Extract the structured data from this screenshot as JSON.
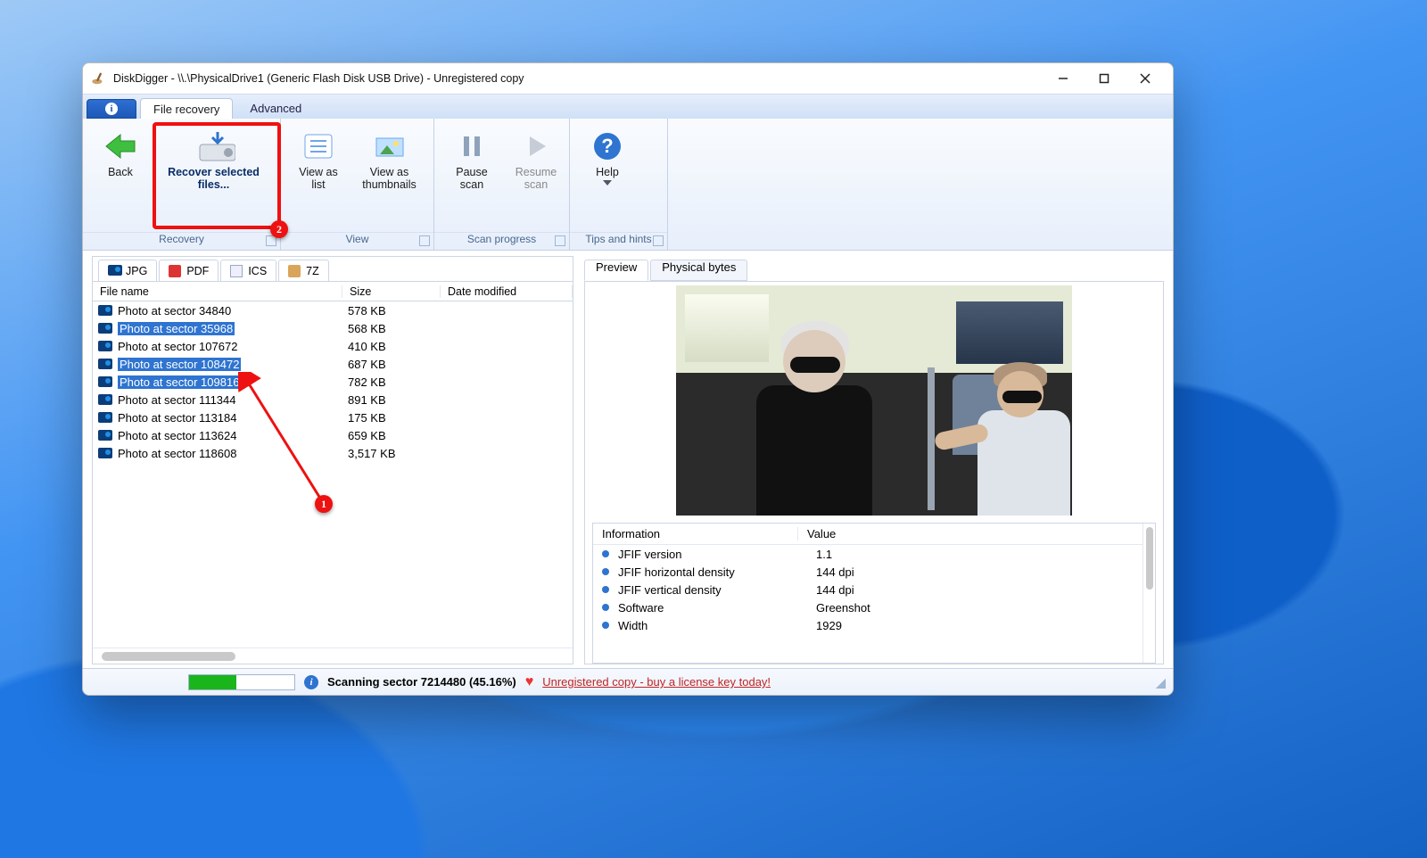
{
  "window": {
    "title": "DiskDigger - \\\\.\\PhysicalDrive1 (Generic Flash Disk USB Drive) - Unregistered copy"
  },
  "tabs": {
    "file_recovery": "File recovery",
    "advanced": "Advanced"
  },
  "ribbon": {
    "back": "Back",
    "recover": "Recover selected files...",
    "view_list": "View as list",
    "view_thumbs": "View as thumbnails",
    "pause": "Pause scan",
    "resume": "Resume scan",
    "help": "Help",
    "group_recovery": "Recovery",
    "group_view": "View",
    "group_scan": "Scan progress",
    "group_tips": "Tips and hints"
  },
  "file_types": {
    "jpg": "JPG",
    "pdf": "PDF",
    "ics": "ICS",
    "sevenz": "7Z"
  },
  "columns": {
    "name": "File name",
    "size": "Size",
    "modified": "Date modified"
  },
  "files": [
    {
      "name": "Photo at sector 34840",
      "size": "578 KB",
      "selected": false
    },
    {
      "name": "Photo at sector 35968",
      "size": "568 KB",
      "selected": true
    },
    {
      "name": "Photo at sector 107672",
      "size": "410 KB",
      "selected": false
    },
    {
      "name": "Photo at sector 108472",
      "size": "687 KB",
      "selected": true
    },
    {
      "name": "Photo at sector 109816",
      "size": "782 KB",
      "selected": true
    },
    {
      "name": "Photo at sector 111344",
      "size": "891 KB",
      "selected": false
    },
    {
      "name": "Photo at sector 113184",
      "size": "175 KB",
      "selected": false
    },
    {
      "name": "Photo at sector 113624",
      "size": "659 KB",
      "selected": false
    },
    {
      "name": "Photo at sector 118608",
      "size": "3,517 KB",
      "selected": false
    }
  ],
  "preview_tabs": {
    "preview": "Preview",
    "bytes": "Physical bytes"
  },
  "info_header": {
    "c1": "Information",
    "c2": "Value"
  },
  "info": [
    {
      "k": "JFIF version",
      "v": "1.1"
    },
    {
      "k": "JFIF horizontal density",
      "v": "144 dpi"
    },
    {
      "k": "JFIF vertical density",
      "v": "144 dpi"
    },
    {
      "k": "Software",
      "v": "Greenshot"
    },
    {
      "k": "Width",
      "v": "1929"
    }
  ],
  "status": {
    "text": "Scanning sector 7214480 (45.16%)",
    "unreg": "Unregistered copy - buy a license key today!"
  },
  "badges": {
    "one": "1",
    "two": "2"
  }
}
